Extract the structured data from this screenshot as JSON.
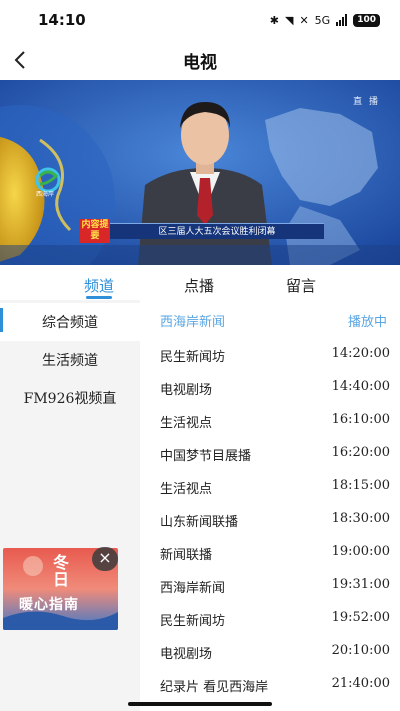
{
  "status_bar": {
    "time": "14:10",
    "network": "5G",
    "battery": "100"
  },
  "nav": {
    "back_icon": "chevron-left-icon",
    "title": "电视"
  },
  "video": {
    "watermark": "直 播",
    "logo_caption": "西海岸",
    "ticker_tag": "内容提要",
    "ticker_text": "区三届人大五次会议胜利闭幕"
  },
  "tabs": [
    {
      "label": "频道",
      "active": true
    },
    {
      "label": "点播",
      "active": false
    },
    {
      "label": "留言",
      "active": false
    }
  ],
  "sidebar": {
    "items": [
      {
        "label": "综合频道",
        "active": true
      },
      {
        "label": "生活频道",
        "active": false
      },
      {
        "label": "FM926视频直",
        "active": false
      }
    ]
  },
  "ad": {
    "line1": "冬日",
    "line2": "暖心指南",
    "close_icon": "close-icon"
  },
  "schedule": {
    "channel": "西海岸新闻",
    "status": "播放中",
    "programs": [
      {
        "name": "民生新闻坊",
        "time": "14:20:00"
      },
      {
        "name": "电视剧场",
        "time": "14:40:00"
      },
      {
        "name": "生活视点",
        "time": "16:10:00"
      },
      {
        "name": "中国梦节目展播",
        "time": "16:20:00"
      },
      {
        "name": "生活视点",
        "time": "18:15:00"
      },
      {
        "name": "山东新闻联播",
        "time": "18:30:00"
      },
      {
        "name": "新闻联播",
        "time": "19:00:00"
      },
      {
        "name": "西海岸新闻",
        "time": "19:31:00"
      },
      {
        "name": "民生新闻坊",
        "time": "19:52:00"
      },
      {
        "name": "电视剧场",
        "time": "20:10:00"
      },
      {
        "name": "纪录片 看见西海岸",
        "time": "21:40:00"
      }
    ]
  },
  "colors": {
    "accent": "#2f8fd9",
    "schedule_header": "#5aa6e3",
    "sidebar_bg": "#f4f4f4"
  }
}
